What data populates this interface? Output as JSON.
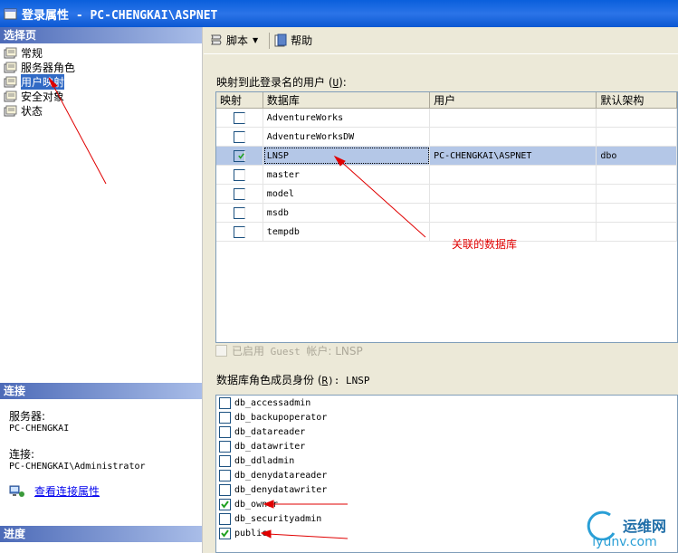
{
  "window": {
    "title": "登录属性 - PC-CHENGKAI\\ASPNET"
  },
  "left_panel": {
    "select_page_header": "选择页",
    "pages": [
      {
        "label": "常规",
        "active": false
      },
      {
        "label": "服务器角色",
        "active": false
      },
      {
        "label": "用户映射",
        "active": true
      },
      {
        "label": "安全对象",
        "active": false
      },
      {
        "label": "状态",
        "active": false
      }
    ],
    "connection_header": "连接",
    "server_label": "服务器:",
    "server_value": "PC-CHENGKAI",
    "connection_label": "连接:",
    "connection_value": "PC-CHENGKAI\\Administrator",
    "view_connection_link": "查看连接属性",
    "progress_header": "进度"
  },
  "toolbar": {
    "script_label": "脚本",
    "help_label": "帮助"
  },
  "mapping": {
    "caption": "映射到此登录名的用户 (",
    "caption_key": "U",
    "caption_end": "):",
    "columns": [
      "映射",
      "数据库",
      "用户",
      "默认架构"
    ],
    "rows": [
      {
        "mapped": false,
        "database": "AdventureWorks",
        "user": "",
        "schema": "",
        "selected": false
      },
      {
        "mapped": false,
        "database": "AdventureWorksDW",
        "user": "",
        "schema": "",
        "selected": false
      },
      {
        "mapped": true,
        "database": "LNSP",
        "user": "PC-CHENGKAI\\ASPNET",
        "schema": "dbo",
        "selected": true
      },
      {
        "mapped": false,
        "database": "master",
        "user": "",
        "schema": "",
        "selected": false
      },
      {
        "mapped": false,
        "database": "model",
        "user": "",
        "schema": "",
        "selected": false
      },
      {
        "mapped": false,
        "database": "msdb",
        "user": "",
        "schema": "",
        "selected": false
      },
      {
        "mapped": false,
        "database": "tempdb",
        "user": "",
        "schema": "",
        "selected": false
      }
    ]
  },
  "guest": {
    "label": "已启用",
    "label_mono": " Guest ",
    "label_end": "帐户: LNSP"
  },
  "roles": {
    "caption": "数据库角色成员身份 (",
    "caption_key": "R",
    "caption_end": "): LNSP",
    "items": [
      {
        "name": "db_accessadmin",
        "checked": false
      },
      {
        "name": "db_backupoperator",
        "checked": false
      },
      {
        "name": "db_datareader",
        "checked": false
      },
      {
        "name": "db_datawriter",
        "checked": false
      },
      {
        "name": "db_ddladmin",
        "checked": false
      },
      {
        "name": "db_denydatareader",
        "checked": false
      },
      {
        "name": "db_denydatawriter",
        "checked": false
      },
      {
        "name": "db_owner",
        "checked": true
      },
      {
        "name": "db_securityadmin",
        "checked": false
      },
      {
        "name": "public",
        "checked": true
      }
    ]
  },
  "annotation": {
    "text": "关联的数据库"
  },
  "watermark": {
    "brand": "运维网",
    "url": "iyunv.com"
  },
  "colors": {
    "selection": "#b4c7e7",
    "accent": "#316ac5",
    "annotation": "#e00000"
  }
}
